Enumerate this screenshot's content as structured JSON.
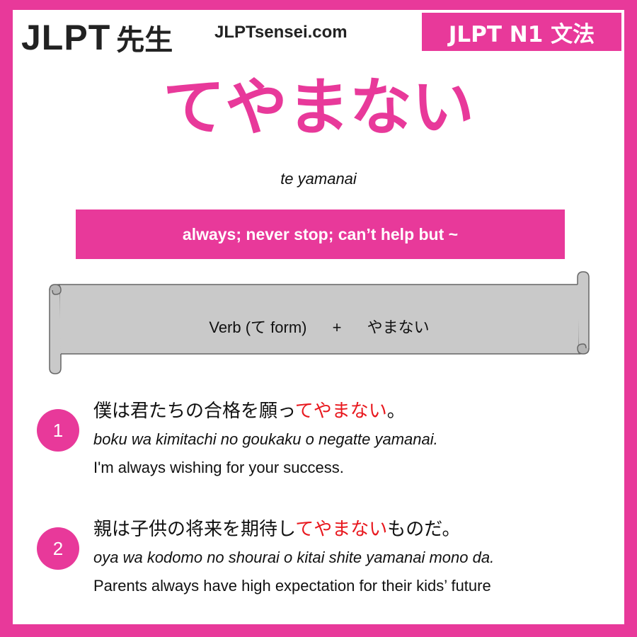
{
  "header": {
    "logo_text": "JLPT",
    "logo_kanji": "先生",
    "site": "JLPTsensei.com",
    "level_badge": "JLPT N1 文法"
  },
  "grammar": {
    "title": "てやまない",
    "romaji": "te yamanai",
    "meaning": "always; never stop; can’t help but ~"
  },
  "formation": {
    "part1": "Verb (て form)",
    "plus": "+",
    "part2": "やまない"
  },
  "examples": [
    {
      "number": "1",
      "jp_before": "僕は君たちの合格を願っ",
      "jp_highlight": "てやまない",
      "jp_after": "。",
      "romaji": "boku wa kimitachi no goukaku o negatte yamanai.",
      "english": "I'm always wishing for your success."
    },
    {
      "number": "2",
      "jp_before": "親は子供の将来を期待し",
      "jp_highlight": "てやまない",
      "jp_after": "ものだ。",
      "romaji": "oya wa kodomo no shourai o kitai shite yamanai mono da.",
      "english": "Parents always have high expectation for their kids’ future"
    }
  ],
  "colors": {
    "brand": "#e8399a",
    "highlight": "#e8181e",
    "scroll": "#c9c9c9"
  }
}
